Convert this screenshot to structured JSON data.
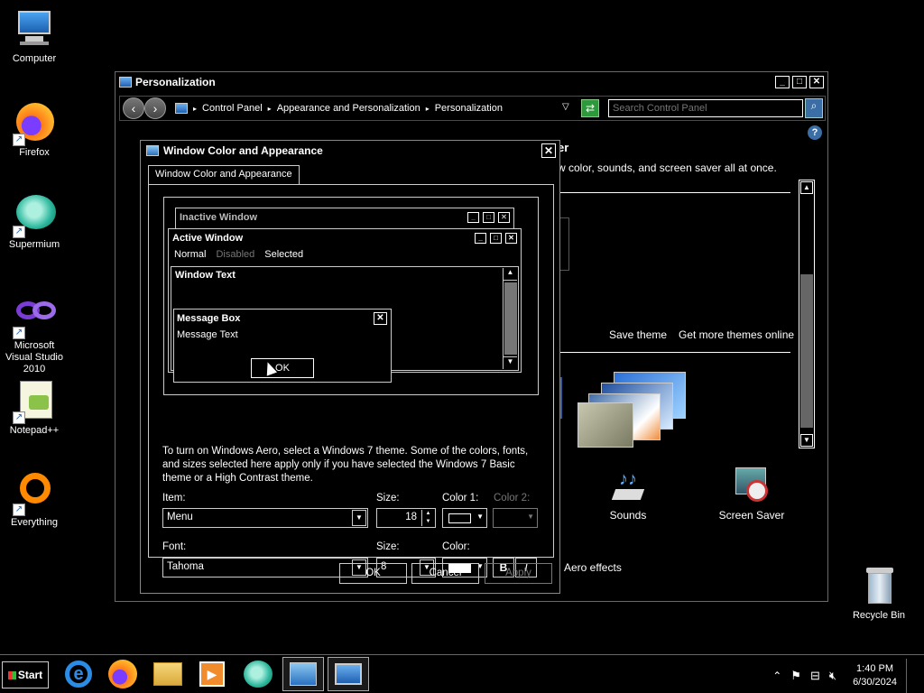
{
  "desktop": {
    "icons": [
      {
        "label": "Computer"
      },
      {
        "label": "Firefox"
      },
      {
        "label": "Supermium"
      },
      {
        "label": "Microsoft Visual Studio 2010"
      },
      {
        "label": "Notepad++"
      },
      {
        "label": "Everything"
      },
      {
        "label": "Recycle Bin"
      }
    ]
  },
  "main_window": {
    "title": "Personalization",
    "breadcrumbs": [
      "Control Panel",
      "Appearance and Personalization",
      "Personalization"
    ],
    "search_placeholder": "Search Control Panel",
    "partial_heading": "er",
    "partial_desc": "w color, sounds, and screen saver all at once.",
    "save_theme": "Save theme",
    "more_themes": "Get more themes online",
    "sounds": "Sounds",
    "screen_saver": "Screen Saver",
    "aero_effects": "Aero effects"
  },
  "dialog": {
    "title": "Window Color and Appearance",
    "tab": "Window Color and Appearance",
    "preview": {
      "inactive_title": "Inactive Window",
      "active_title": "Active Window",
      "menu_normal": "Normal",
      "menu_disabled": "Disabled",
      "menu_selected": "Selected",
      "window_text": "Window Text",
      "msgbox_title": "Message Box",
      "msgbox_text": "Message Text",
      "msgbox_ok": "OK"
    },
    "note": "To turn on Windows Aero, select a Windows 7 theme.  Some of the colors, fonts, and sizes selected here apply only if you have selected the Windows 7 Basic theme or a High Contrast theme.",
    "item_label": "Item:",
    "item_value": "Menu",
    "size_label": "Size:",
    "size_value": "18",
    "color1_label": "Color 1:",
    "color2_label": "Color 2:",
    "font_label": "Font:",
    "font_value": "Tahoma",
    "font_size_label": "Size:",
    "font_size_value": "8",
    "font_color_label": "Color:",
    "bold": "B",
    "italic": "I",
    "ok": "OK",
    "cancel": "Cancel",
    "apply": "Apply"
  },
  "taskbar": {
    "start": "Start",
    "time": "1:40 PM",
    "date": "6/30/2024"
  }
}
